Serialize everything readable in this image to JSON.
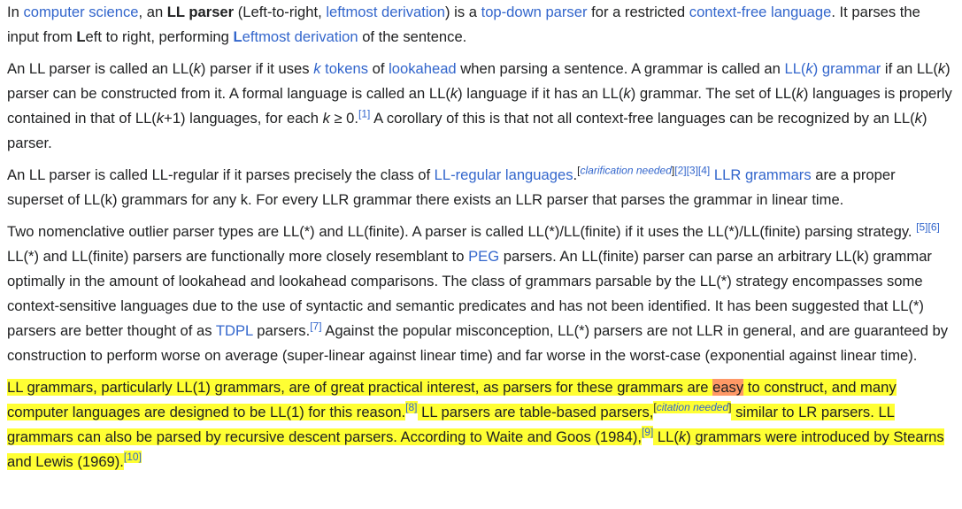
{
  "p1": {
    "t1": "In ",
    "link_cs": "computer science",
    "t2": ", an ",
    "term": "LL parser",
    "t3": " (Left-to-right, ",
    "link_lm": "leftmost derivation",
    "t4": ") is a ",
    "link_td": "top-down parser",
    "t5": " for a restricted ",
    "link_cfl": "context-free language",
    "t6": ". It parses the input from ",
    "bold_L1": "L",
    "t7": "eft to right, performing ",
    "link_lm2_bold": "L",
    "link_lm2_rest": "eftmost derivation",
    "t8": " of the sentence."
  },
  "p2": {
    "t1": "An LL parser is called an LL(",
    "k1": "k",
    "t2": ") parser if it uses ",
    "link_ktok_k": "k",
    "link_ktok_rest": " tokens",
    "t3": " of ",
    "link_la": "lookahead",
    "t4": " when parsing a sentence. A grammar is called an ",
    "link_llg_a": "LL(",
    "link_llg_k": "k",
    "link_llg_b": ") grammar",
    "t5": " if an LL(",
    "k2": "k",
    "t6": ") parser can be constructed from it. A formal language is called an LL(",
    "k3": "k",
    "t7": ") language if it has an LL(",
    "k4": "k",
    "t8": ") grammar. The set of LL(",
    "k5": "k",
    "t9": ") languages is properly contained in that of LL(",
    "k6": "k",
    "t10": "+1) languages, for each ",
    "k7": "k",
    "t11": " ≥ 0.",
    "ref1": "[1]",
    "t12": " A corollary of this is that not all context-free languages can be recognized by an LL(",
    "k8": "k",
    "t13": ") parser."
  },
  "p3": {
    "t1": "An LL parser is called LL-regular if it parses precisely the class of ",
    "link_llreg": "LL-regular languages",
    "t2": ".",
    "sup_open": "[",
    "clarif": "clarification needed",
    "sup_close": "]",
    "ref2": "[2]",
    "ref3": "[3]",
    "ref4": "[4]",
    "t3": " ",
    "link_llr": "LLR grammars",
    "t4": " are a proper superset of LL(k) grammars for any k. For every LLR grammar there exists an LLR parser that parses the grammar in linear time."
  },
  "p4": {
    "t1": "Two nomenclative outlier parser types are LL(*) and LL(finite). A parser is called LL(*)/LL(finite) if it uses the LL(*)/LL(finite) parsing strategy. ",
    "ref5": "[5]",
    "ref6": "[6]",
    "t2": " LL(*) and LL(finite) parsers are functionally more closely resemblant to ",
    "link_peg": "PEG",
    "t3": " parsers. An LL(finite) parser can parse an arbitrary LL(k) grammar optimally in the amount of lookahead and lookahead comparisons. The class of grammars parsable by the LL(*) strategy encompasses some context-sensitive languages due to the use of syntactic and semantic predicates and has not been identified. It has been suggested that LL(*) parsers are better thought of as ",
    "link_tdpl": "TDPL",
    "t4": " parsers.",
    "ref7": "[7]",
    "t5": " Against the popular misconception, LL(*) parsers are not LLR in general, and are guaranteed by construction to perform worse on average (super-linear against linear time) and far worse in the worst-case (exponential against linear time)."
  },
  "p5": {
    "t1": "LL grammars, particularly LL(1) grammars, are of great practical interest, as parsers for these grammars are ",
    "strong": "easy",
    "t2": " to construct, and many computer languages are designed to be LL(1) for this reason.",
    "ref8": "[8]",
    "t3": " LL parsers are table-based parsers,",
    "sup_open": "[",
    "citation": "citation needed",
    "sup_close": "]",
    "t4": " similar to LR parsers. LL grammars can also be parsed by recursive descent parsers. According to Waite and Goos (1984),",
    "ref9": "[9]",
    "t5": " LL(",
    "k1": "k",
    "t6": ") grammars were introduced by Stearns and Lewis (1969).",
    "ref10": "[10]"
  },
  "colors": {
    "text": "#202122",
    "link": "#3366cc",
    "highlight": "#ffff33",
    "highlight_strong": "#ff9966"
  }
}
